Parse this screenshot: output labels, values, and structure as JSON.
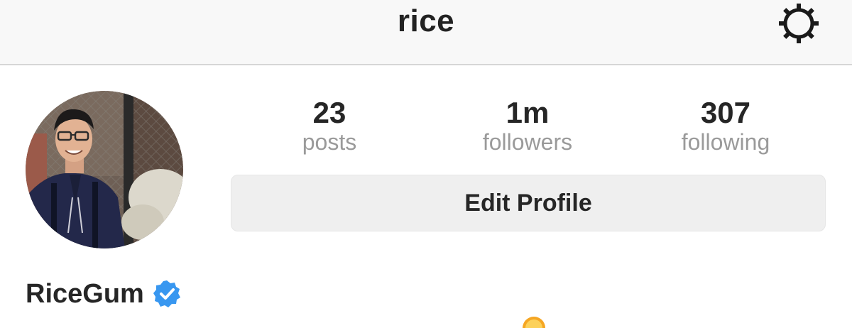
{
  "header": {
    "title": "rice",
    "settings_icon": "gear-icon"
  },
  "profile": {
    "avatar_icon": "profile-photo",
    "display_name": "RiceGum",
    "verified_icon": "verified-badge-icon",
    "verified_color": "#3897f0"
  },
  "stats": [
    {
      "value": "23",
      "label": "posts"
    },
    {
      "value": "1m",
      "label": "followers"
    },
    {
      "value": "307",
      "label": "following"
    }
  ],
  "actions": {
    "edit_profile_label": "Edit Profile"
  },
  "colors": {
    "header_bg": "#f8f8f8",
    "muted_text": "#9a9a9a",
    "button_bg": "#efefef",
    "emoji_orange": "#f5a623"
  }
}
